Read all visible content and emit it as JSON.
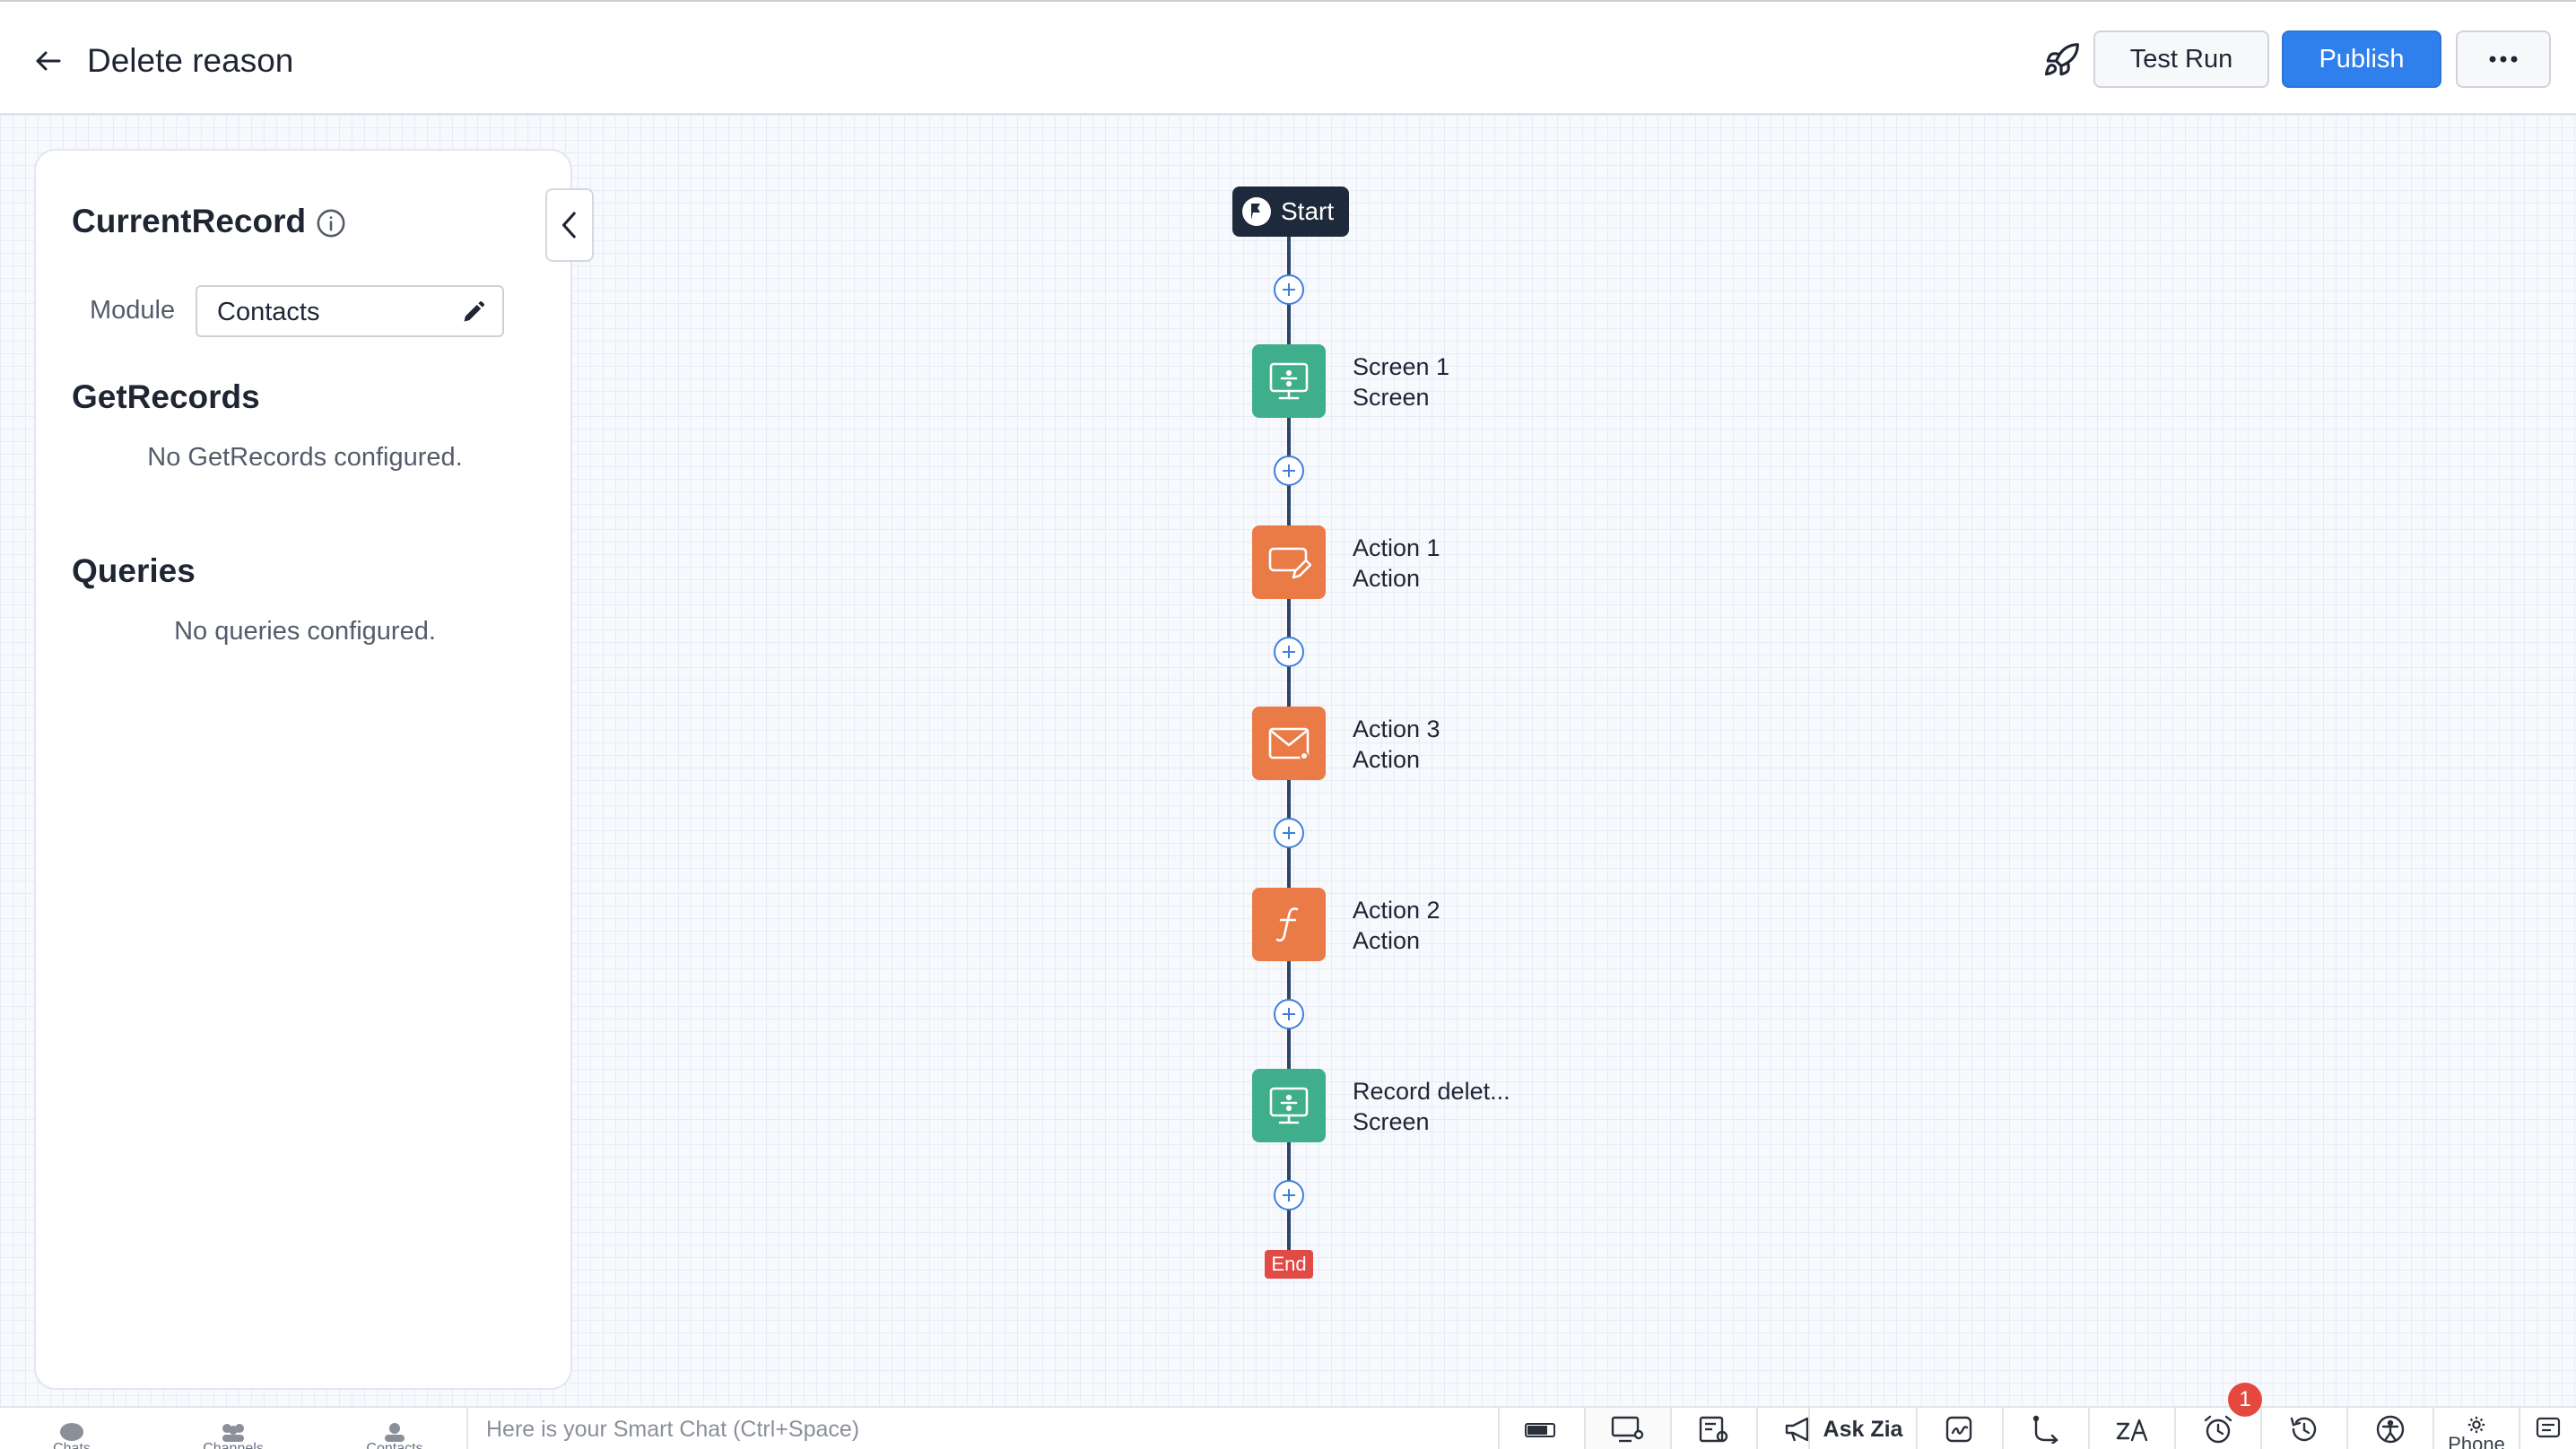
{
  "header": {
    "title": "Delete reason",
    "test_run": "Test Run",
    "publish": "Publish"
  },
  "panel": {
    "current_record_title": "CurrentRecord",
    "module_label": "Module",
    "module_value": "Contacts",
    "get_records_title": "GetRecords",
    "get_records_empty": "No GetRecords configured.",
    "queries_title": "Queries",
    "queries_empty": "No queries configured."
  },
  "flow": {
    "start": "Start",
    "end": "End",
    "nodes": [
      {
        "title": "Screen 1",
        "subtitle": "Screen",
        "kind": "screen",
        "icon": "screen-icon"
      },
      {
        "title": "Action 1",
        "subtitle": "Action",
        "kind": "action",
        "icon": "edit-record-icon"
      },
      {
        "title": "Action 3",
        "subtitle": "Action",
        "kind": "action",
        "icon": "mail-icon"
      },
      {
        "title": "Action 2",
        "subtitle": "Action",
        "kind": "action",
        "icon": "function-icon"
      },
      {
        "title": "Record delet...",
        "subtitle": "Screen",
        "kind": "screen",
        "icon": "screen-icon"
      }
    ]
  },
  "bottombar": {
    "chats": "Chats",
    "channels": "Channels",
    "contacts": "Contacts",
    "smart_chat_placeholder": "Here is your Smart Chat (Ctrl+Space)",
    "ask_zia": "Ask Zia",
    "notification_count": "1",
    "phone": "Phone"
  },
  "colors": {
    "primary": "#2f80ed",
    "screen_node": "#3fae8a",
    "action_node": "#ea7a46",
    "end_node": "#e24a45",
    "start_node": "#1e2a3b"
  }
}
